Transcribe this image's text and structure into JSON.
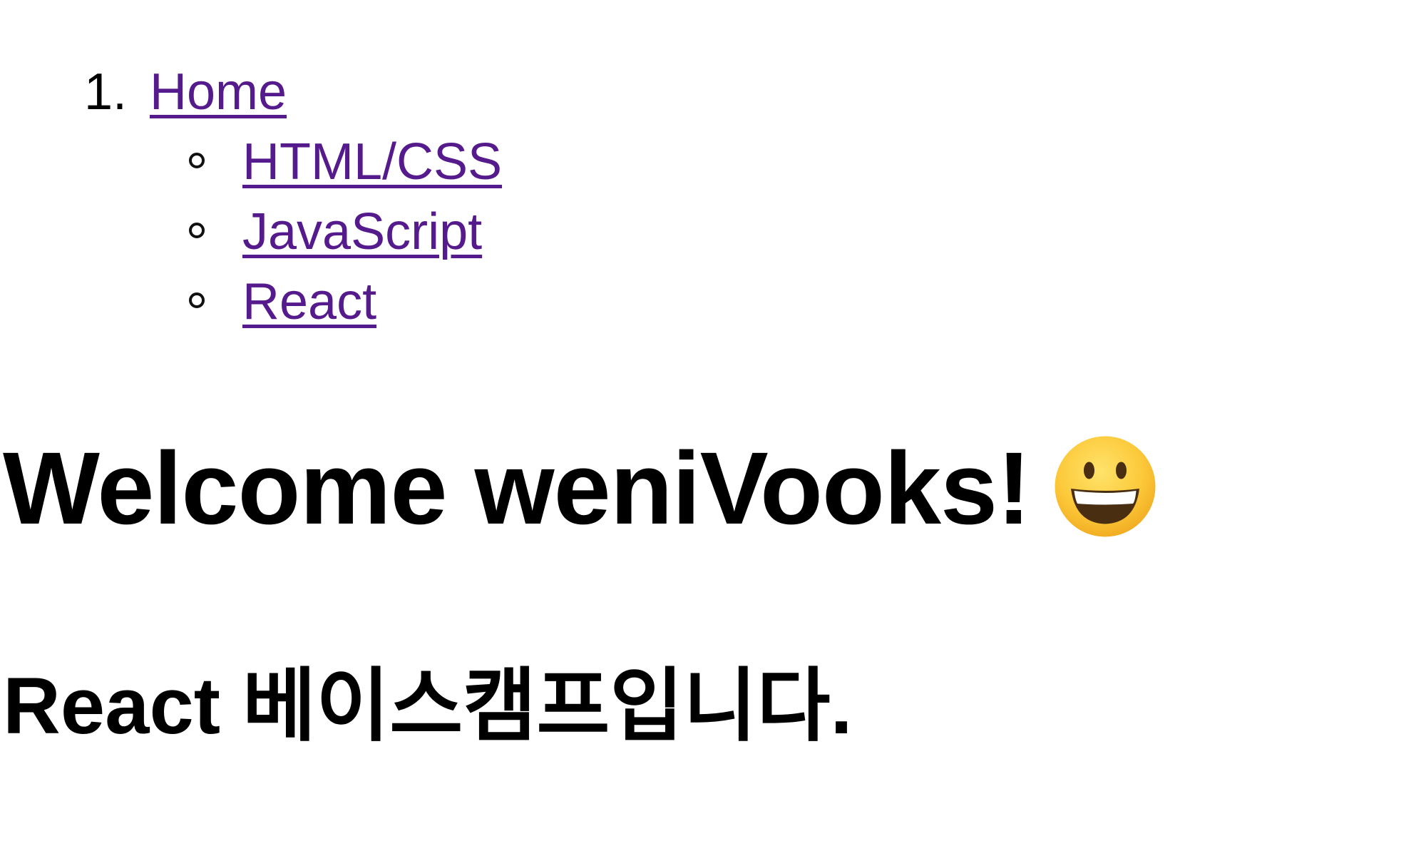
{
  "nav": {
    "ordinal": "1.",
    "home_label": "Home",
    "items": [
      {
        "label": "HTML/CSS"
      },
      {
        "label": "JavaScript"
      },
      {
        "label": "React"
      }
    ],
    "link_color": "#551a8b"
  },
  "heading": {
    "title": "Welcome weniVooks!",
    "emoji": "grinning-face-icon"
  },
  "subheading": {
    "text": "React 베이스캠프입니다."
  }
}
